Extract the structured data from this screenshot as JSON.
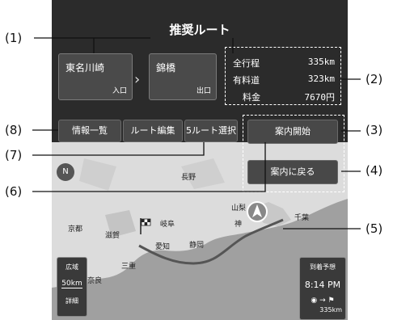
{
  "header": {
    "title": "推奨ルート"
  },
  "route": {
    "start": {
      "name": "東名川崎",
      "tag": "入口"
    },
    "end": {
      "name": "錦橋",
      "tag": "出口"
    },
    "arrow": "›"
  },
  "summary": [
    {
      "label": "全行程",
      "value": "335km"
    },
    {
      "label": "有料道",
      "value": "323km"
    },
    {
      "label": "料金",
      "value": "7670円"
    }
  ],
  "buttons": {
    "info_list": "情報一覧",
    "route_edit": "ルート編集",
    "five_routes": "5ルート選択",
    "start_guidance": "案内開始",
    "back_to_guidance": "案内に戻る"
  },
  "callouts": [
    "(1)",
    "(2)",
    "(3)",
    "(4)",
    "(5)",
    "(6)",
    "(7)",
    "(8)"
  ],
  "map": {
    "compass": "N",
    "place_names": [
      "長野",
      "山梨",
      "千葉",
      "京都",
      "滋賀",
      "岐阜",
      "神",
      "愛知",
      "静岡",
      "三重",
      "奈良"
    ],
    "scale": {
      "wide": "広域",
      "distance": "50km",
      "detail": "詳細"
    },
    "eta": {
      "label": "到着予想",
      "time": "8:14 PM",
      "distance": "335km"
    }
  },
  "colors": {
    "background": "#2b2b2b",
    "button": "#484848",
    "route": "#666666",
    "map_land": "#d9d9d9",
    "map_sea": "#9c9c9c"
  },
  "icons": [
    "compass-icon",
    "current-position-icon",
    "destination-flag-icon",
    "arrow-right-icon"
  ]
}
